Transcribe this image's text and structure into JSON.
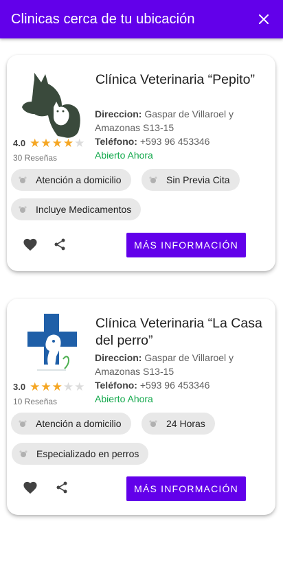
{
  "appbar": {
    "title": "Clinicas cerca de tu ubicación",
    "close_icon": "close-icon"
  },
  "colors": {
    "primary": "#6200ea",
    "open": "#12a84b",
    "star": "#f5a623"
  },
  "labels": {
    "direccion": "Direccion:",
    "telefono": "Teléfono:"
  },
  "clinics": [
    {
      "name": "Clínica Veterinaria “Pepito”",
      "logo": "dog-cat-logo",
      "rating": "4.0",
      "rating_value": 4,
      "reviews": "30 Reseñas",
      "address": "Gaspar de Villaroel y Amazonas S13-15",
      "phone": "+593 96 453346",
      "status": "Abierto Ahora",
      "chips": [
        "Atención a domicilio",
        "Sin Previa Cita",
        "Incluye Medicamentos"
      ],
      "button": "MÁS INFORMACIÓN"
    },
    {
      "name": "Clínica Veterinaria “La Casa del perro”",
      "logo": "medical-cross-dog-logo",
      "rating": "3.0",
      "rating_value": 3,
      "reviews": "10 Reseñas",
      "address": "Gaspar de Villaroel y Amazonas S13-15",
      "phone": "+593 96 453346",
      "status": "Abierto Ahora",
      "chips": [
        "Atención a domicilio",
        "24 Horas",
        "Especializado en perros"
      ],
      "button": "MÁS INFORMACIÓN"
    }
  ]
}
